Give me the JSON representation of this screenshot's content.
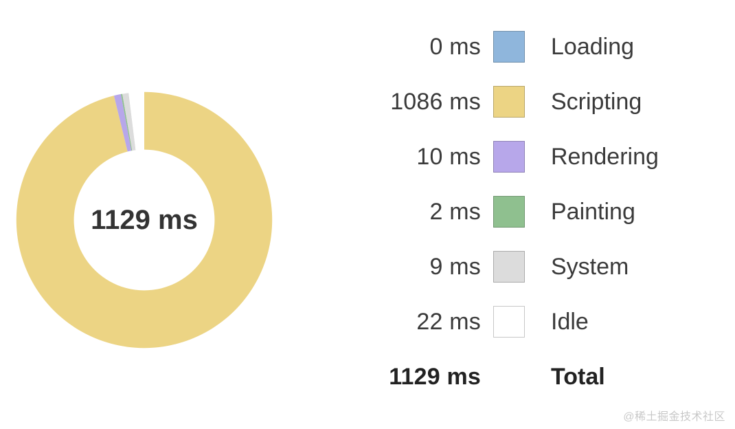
{
  "center_label": "1129 ms",
  "legend": [
    {
      "name": "Loading",
      "value_label": "0 ms",
      "color": "#8fb6dc"
    },
    {
      "name": "Scripting",
      "value_label": "1086 ms",
      "color": "#ecd484"
    },
    {
      "name": "Rendering",
      "value_label": "10 ms",
      "color": "#b7a7ea"
    },
    {
      "name": "Painting",
      "value_label": "2 ms",
      "color": "#8fc08f"
    },
    {
      "name": "System",
      "value_label": "9 ms",
      "color": "#dcdcdc"
    },
    {
      "name": "Idle",
      "value_label": "22 ms",
      "color": "#ffffff"
    }
  ],
  "total": {
    "name": "Total",
    "value_label": "1129 ms"
  },
  "watermark": "@稀土掘金技术社区",
  "chart_data": {
    "type": "pie",
    "title": "",
    "style": "donut",
    "inner_radius_ratio": 0.55,
    "center_label": "1129 ms",
    "unit": "ms",
    "total": 1129,
    "series": [
      {
        "name": "Loading",
        "value": 0,
        "color": "#8fb6dc"
      },
      {
        "name": "Scripting",
        "value": 1086,
        "color": "#ecd484"
      },
      {
        "name": "Rendering",
        "value": 10,
        "color": "#b7a7ea"
      },
      {
        "name": "Painting",
        "value": 2,
        "color": "#8fc08f"
      },
      {
        "name": "System",
        "value": 9,
        "color": "#dcdcdc"
      },
      {
        "name": "Idle",
        "value": 22,
        "color": "#ffffff"
      }
    ]
  }
}
